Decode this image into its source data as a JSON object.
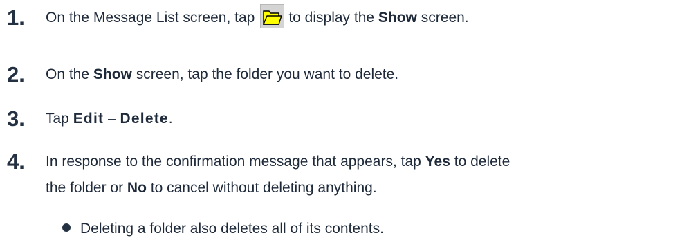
{
  "steps": [
    {
      "number": "1.",
      "parts": {
        "a": "On the Message List screen, tap",
        "b": "to display the",
        "c": "Show",
        "d": "screen."
      }
    },
    {
      "number": "2.",
      "parts": {
        "a": "On the",
        "b": "Show",
        "c": "screen, tap the folder you want to delete."
      }
    },
    {
      "number": "3.",
      "parts": {
        "a": "Tap",
        "b": "Edit",
        "c": "–",
        "d": "Delete",
        "e": "."
      }
    },
    {
      "number": "4.",
      "line1": {
        "a": "In response to the confirmation message that appears, tap",
        "b": "Yes",
        "c": "to delete"
      },
      "line2": {
        "a": "the folder or",
        "b": "No",
        "c": "to cancel without deleting anything."
      }
    }
  ],
  "note": "Deleting a folder also deletes all of its contents.",
  "icons": {
    "folder_button": "folder-open-icon",
    "folder_color": "#ffff00",
    "bullet": "bullet-icon"
  }
}
